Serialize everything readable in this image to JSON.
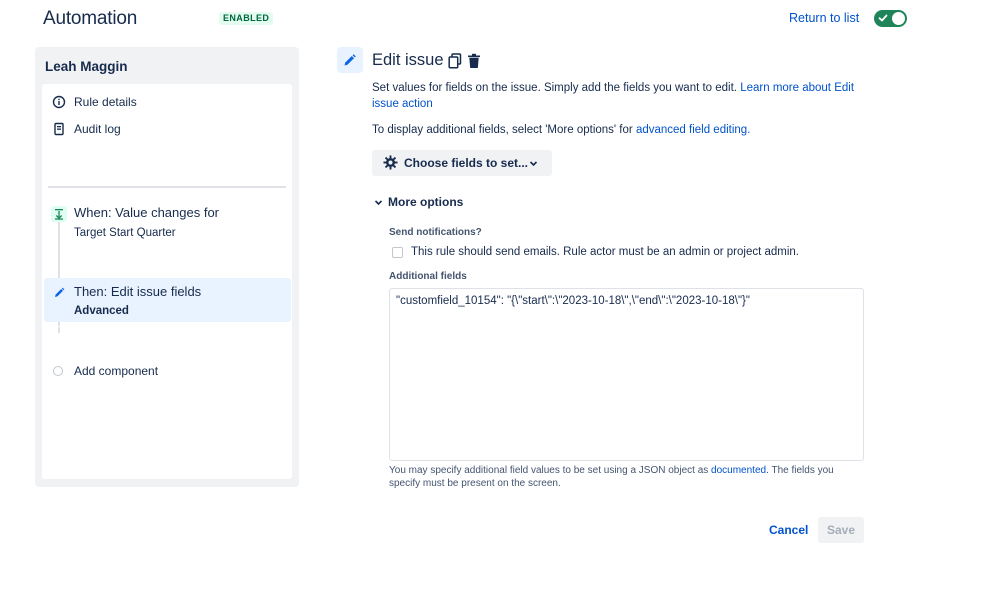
{
  "header": {
    "title": "Automation",
    "status": "ENABLED",
    "return_link": "Return to list",
    "toggle_on": true,
    "accent": "#1f845a"
  },
  "sidebar": {
    "owner": "Leah Maggin",
    "nav": [
      {
        "label": "Rule details",
        "icon": "info-icon"
      },
      {
        "label": "Audit log",
        "icon": "audit-log-icon"
      }
    ],
    "trigger": {
      "title": "When: Value changes for",
      "subtitle": "Target Start Quarter",
      "icon": "trigger-icon"
    },
    "action": {
      "title": "Then: Edit issue fields",
      "subtitle": "Advanced",
      "icon": "pencil-icon",
      "selected": true
    },
    "add_component": "Add component"
  },
  "editor": {
    "title": "Edit issue",
    "description_text": "Set values for fields on the issue. Simply add the fields you want to edit.",
    "learn_more_line1": "Learn more about Edit",
    "learn_more_line2": "issue action",
    "display_text": "To display additional fields, select 'More options' for",
    "advanced_link": "advanced field editing.",
    "choose_fields": "Choose fields to set...",
    "more_options": "More options",
    "send_notifications_label": "Send notifications?",
    "send_emails_text": "This rule should send emails. Rule actor must be an admin or project admin.",
    "send_emails_checked": false,
    "additional_fields_label": "Additional fields",
    "additional_fields_value": "\"customfield_10154\": \"{\\\"start\\\":\\\"2023-10-18\\\",\\\"end\\\":\\\"2023-10-18\\\"}\"",
    "helper_text_1": "You may specify additional field values to be set using a JSON object as",
    "helper_link": "documented",
    "helper_text_2": ". The fields you",
    "helper_text_3": "specify must be present on the screen.",
    "cancel": "Cancel",
    "save": "Save"
  }
}
